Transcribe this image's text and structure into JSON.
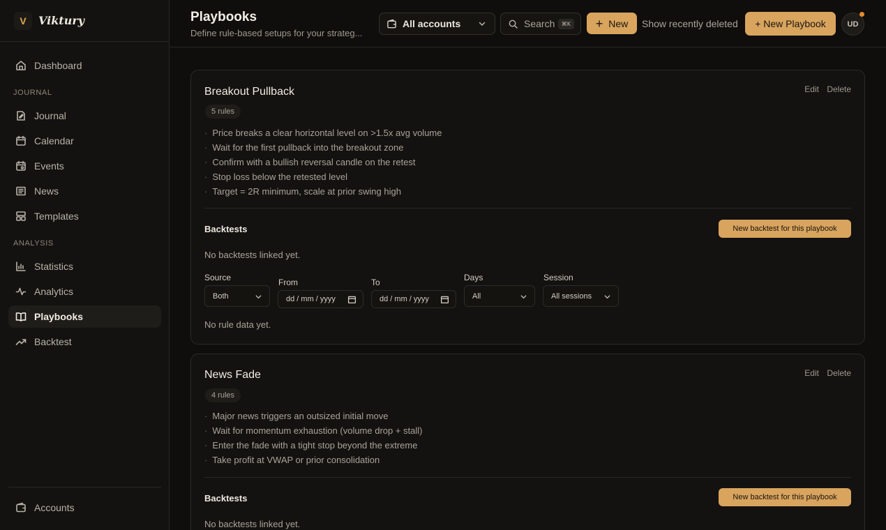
{
  "brand": {
    "logo_letter": "V",
    "name": "Viktury"
  },
  "sidebar": {
    "dashboard": "Dashboard",
    "journal_section": "JOURNAL",
    "journal_items": [
      "Journal",
      "Calendar",
      "Events",
      "News",
      "Templates"
    ],
    "analysis_section": "ANALYSIS",
    "analysis_items": [
      "Statistics",
      "Analytics",
      "Playbooks",
      "Backtest"
    ],
    "active_item": "Playbooks",
    "accounts": "Accounts"
  },
  "header": {
    "title": "Playbooks",
    "subtitle": "Define rule-based setups for your strateg...",
    "account_select": "All accounts",
    "search_label": "Search",
    "search_shortcut": "⌘K",
    "new_label": "New",
    "show_deleted": "Show recently deleted",
    "new_playbook": "+ New Playbook",
    "avatar_initials": "UD"
  },
  "colors": {
    "accent": "#d9a45e",
    "background": "#0f0e0c",
    "notification": "#e88a2b"
  },
  "playbooks": [
    {
      "title": "Breakout Pullback",
      "rule_count": "5 rules",
      "edit": "Edit",
      "delete": "Delete",
      "rules": [
        "Price breaks a clear horizontal level on >1.5x avg volume",
        "Wait for the first pullback into the breakout zone",
        "Confirm with a bullish reversal candle on the retest",
        "Stop loss below the retested level",
        "Target = 2R minimum, scale at prior swing high"
      ],
      "backtests_title": "Backtests",
      "new_backtest": "New backtest for this playbook",
      "no_backtests": "No backtests linked yet.",
      "filters": {
        "source_label": "Source",
        "source_value": "Both",
        "from_label": "From",
        "from_placeholder": "dd / mm / yyyy",
        "to_label": "To",
        "to_placeholder": "dd / mm / yyyy",
        "days_label": "Days",
        "days_value": "All",
        "session_label": "Session",
        "session_value": "All sessions"
      },
      "no_rule_data": "No rule data yet."
    },
    {
      "title": "News Fade",
      "rule_count": "4 rules",
      "edit": "Edit",
      "delete": "Delete",
      "rules": [
        "Major news triggers an outsized initial move",
        "Wait for momentum exhaustion (volume drop + stall)",
        "Enter the fade with a tight stop beyond the extreme",
        "Take profit at VWAP or prior consolidation"
      ],
      "backtests_title": "Backtests",
      "new_backtest": "New backtest for this playbook",
      "no_backtests": "No backtests linked yet."
    }
  ]
}
